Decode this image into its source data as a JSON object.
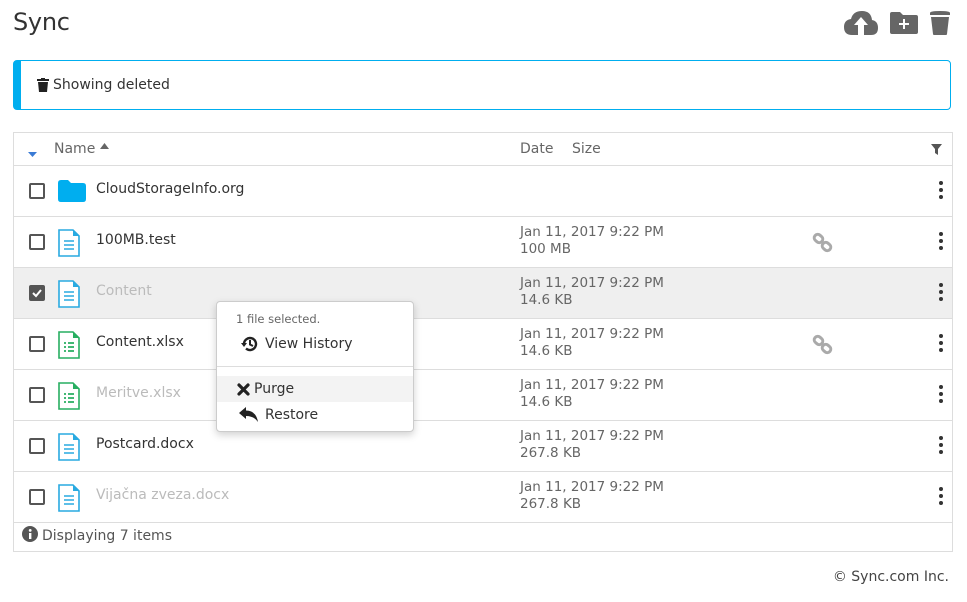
{
  "header": {
    "title": "Sync",
    "actions": [
      {
        "name": "upload-icon",
        "label": "Upload"
      },
      {
        "name": "new-folder-icon",
        "label": "New folder"
      },
      {
        "name": "trash-icon",
        "label": "Deleted files"
      }
    ]
  },
  "alert": {
    "icon": "trash-icon",
    "text": "Showing deleted"
  },
  "table": {
    "columns": {
      "name": "Name",
      "date": "Date",
      "size": "Size"
    },
    "sort": {
      "column": "Name",
      "direction": "asc"
    },
    "rows": [
      {
        "name": "CloudStorageInfo.org",
        "type": "folder",
        "date": "",
        "size": "",
        "checked": false,
        "deleted": false,
        "linked": false
      },
      {
        "name": "100MB.test",
        "type": "document",
        "date": "Jan 11, 2017 9:22 PM",
        "size": "100 MB",
        "checked": false,
        "deleted": false,
        "linked": true
      },
      {
        "name": "Content",
        "type": "document",
        "date": "Jan 11, 2017 9:22 PM",
        "size": "14.6 KB",
        "checked": true,
        "deleted": true,
        "linked": false
      },
      {
        "name": "Content.xlsx",
        "type": "spreadsheet",
        "date": "Jan 11, 2017 9:22 PM",
        "size": "14.6 KB",
        "checked": false,
        "deleted": false,
        "linked": true
      },
      {
        "name": "Meritve.xlsx",
        "type": "spreadsheet",
        "date": "Jan 11, 2017 9:22 PM",
        "size": "14.6 KB",
        "checked": false,
        "deleted": true,
        "linked": false
      },
      {
        "name": "Postcard.docx",
        "type": "document",
        "date": "Jan 11, 2017 9:22 PM",
        "size": "267.8 KB",
        "checked": false,
        "deleted": false,
        "linked": false
      },
      {
        "name": "Vijačna zveza.docx",
        "type": "document",
        "date": "Jan 11, 2017 9:22 PM",
        "size": "267.8 KB",
        "checked": false,
        "deleted": true,
        "linked": false
      }
    ],
    "footer": "Displaying 7 items"
  },
  "context_menu": {
    "header": "1 file selected.",
    "items": [
      {
        "label": "View History",
        "icon": "history-icon"
      },
      {
        "label": "Purge",
        "icon": "x-icon"
      },
      {
        "label": "Restore",
        "icon": "reply-icon"
      }
    ]
  },
  "colors": {
    "accent": "#00aeef",
    "spreadsheet": "#27ae60",
    "document": "#29aae1"
  },
  "footer": {
    "copyright": "© Sync.com Inc."
  }
}
